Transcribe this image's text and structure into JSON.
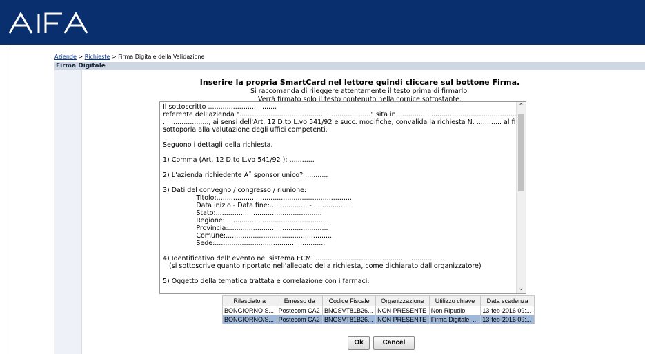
{
  "header": {
    "logo_text": "AIFA"
  },
  "breadcrumb": {
    "items": [
      "Aziende",
      "Richieste"
    ],
    "separator": " > ",
    "current": "Firma Digitale della Validazione"
  },
  "section_title": "Firma Digitale",
  "instructions": {
    "title": "Inserire la propria SmartCard nel lettore quindi cliccare sul bottone Firma.",
    "line1": "Si raccomanda di rileggere attentamente il testo prima di firmarlo.",
    "line2": "Verrà firmato solo il testo contenuto nella cornice sottostante."
  },
  "document_text": [
    "Il sottoscritto .................................",
    "referente dell'azienda \"...............................................................\" sita in ...............................................................",
    "......................, ai sensi dell'Art. 12 D.to L.vo 541/92 e succ. modifiche, convalida la richiesta N. ............ al fine di",
    "sottoporla alla valutazione degli uffici competenti.",
    "",
    "Seguono i dettagli della richiesta.",
    "",
    "1) Comma (Art. 12 D.to L.vo 541/92 ): ............",
    "",
    "2) L'azienda richiedente Ã¨ sponsor unico? ...........",
    "",
    "3) Dati del convegno / congresso / riunione:",
    "                Titolo:.................................................................",
    "                Data inizio - Data fine:.................. - ..................",
    "                Stato:...................................................",
    "                Regione:..................................................",
    "                Provincia:................................................",
    "                Comune:...................................................",
    "                Sede:.....................................................",
    "",
    "4) Identificativo dell' evento nel sistema ECM: ..............................................................",
    "   (si sottoscrive quanto riportato nell'allegato della richiesta, come dichiarato dall'organizzatore)",
    "",
    "5) Oggetto della tematica trattata e correlazione con i farmaci:"
  ],
  "cert_table": {
    "headers": [
      "Rilasciato a",
      "Emesso da",
      "Codice Fiscale",
      "Organizzazione",
      "Utilizzo chiave",
      "Data scadenza"
    ],
    "rows": [
      [
        "BONGIORNO S...",
        "Postecom CA2",
        "BNGSVT81B26...",
        "NON PRESENTE",
        "Non Ripudio",
        "13-feb-2016 09:..."
      ],
      [
        "BONGIORNO/S...",
        "Postecom CA2",
        "BNGSVT81B26...",
        "NON PRESENTE",
        "Firma Digitale, ...",
        "13-feb-2016 09:..."
      ]
    ],
    "selected_row": 1
  },
  "buttons": {
    "ok": "Ok",
    "cancel": "Cancel"
  },
  "colors": {
    "header_bg": "#0a2f6e",
    "section_bg": "#cfd7e3",
    "selected_row": "#9fb7d8"
  }
}
